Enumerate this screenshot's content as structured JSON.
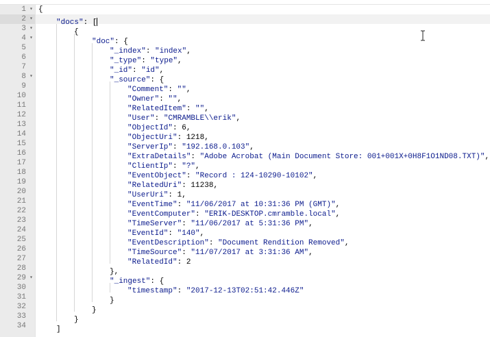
{
  "editor": {
    "active_line": 2,
    "lines": [
      {
        "n": "1",
        "fold": "▾",
        "indent": 0,
        "parts": [
          [
            "p",
            "{"
          ]
        ]
      },
      {
        "n": "2",
        "fold": "▾",
        "indent": 1,
        "parts": [
          [
            "s",
            "\"docs\""
          ],
          [
            "p",
            ": ["
          ]
        ],
        "cursor": true
      },
      {
        "n": "3",
        "fold": "▾",
        "indent": 2,
        "parts": [
          [
            "p",
            "{"
          ]
        ]
      },
      {
        "n": "4",
        "fold": "▾",
        "indent": 3,
        "parts": [
          [
            "s",
            "\"doc\""
          ],
          [
            "p",
            ": {"
          ]
        ]
      },
      {
        "n": "5",
        "fold": "",
        "indent": 4,
        "parts": [
          [
            "s",
            "\"_index\""
          ],
          [
            "p",
            ": "
          ],
          [
            "s",
            "\"index\""
          ],
          [
            "p",
            ","
          ]
        ]
      },
      {
        "n": "6",
        "fold": "",
        "indent": 4,
        "parts": [
          [
            "s",
            "\"_type\""
          ],
          [
            "p",
            ": "
          ],
          [
            "s",
            "\"type\""
          ],
          [
            "p",
            ","
          ]
        ]
      },
      {
        "n": "7",
        "fold": "",
        "indent": 4,
        "parts": [
          [
            "s",
            "\"_id\""
          ],
          [
            "p",
            ": "
          ],
          [
            "s",
            "\"id\""
          ],
          [
            "p",
            ","
          ]
        ]
      },
      {
        "n": "8",
        "fold": "▾",
        "indent": 4,
        "parts": [
          [
            "s",
            "\"_source\""
          ],
          [
            "p",
            ": {"
          ]
        ]
      },
      {
        "n": "9",
        "fold": "",
        "indent": 5,
        "parts": [
          [
            "s",
            "\"Comment\""
          ],
          [
            "p",
            ": "
          ],
          [
            "s",
            "\"\""
          ],
          [
            "p",
            ","
          ]
        ]
      },
      {
        "n": "10",
        "fold": "",
        "indent": 5,
        "parts": [
          [
            "s",
            "\"Owner\""
          ],
          [
            "p",
            ": "
          ],
          [
            "s",
            "\"\""
          ],
          [
            "p",
            ","
          ]
        ]
      },
      {
        "n": "11",
        "fold": "",
        "indent": 5,
        "parts": [
          [
            "s",
            "\"RelatedItem\""
          ],
          [
            "p",
            ": "
          ],
          [
            "s",
            "\"\""
          ],
          [
            "p",
            ","
          ]
        ]
      },
      {
        "n": "12",
        "fold": "",
        "indent": 5,
        "parts": [
          [
            "s",
            "\"User\""
          ],
          [
            "p",
            ": "
          ],
          [
            "s",
            "\"CMRAMBLE\\\\erik\""
          ],
          [
            "p",
            ","
          ]
        ]
      },
      {
        "n": "13",
        "fold": "",
        "indent": 5,
        "parts": [
          [
            "s",
            "\"ObjectId\""
          ],
          [
            "p",
            ": "
          ],
          [
            "n",
            "6"
          ],
          [
            "p",
            ","
          ]
        ]
      },
      {
        "n": "14",
        "fold": "",
        "indent": 5,
        "parts": [
          [
            "s",
            "\"ObjectUri\""
          ],
          [
            "p",
            ": "
          ],
          [
            "n",
            "1218"
          ],
          [
            "p",
            ","
          ]
        ]
      },
      {
        "n": "15",
        "fold": "",
        "indent": 5,
        "parts": [
          [
            "s",
            "\"ServerIp\""
          ],
          [
            "p",
            ": "
          ],
          [
            "s",
            "\"192.168.0.103\""
          ],
          [
            "p",
            ","
          ]
        ]
      },
      {
        "n": "16",
        "fold": "",
        "indent": 5,
        "parts": [
          [
            "s",
            "\"ExtraDetails\""
          ],
          [
            "p",
            ": "
          ],
          [
            "s",
            "\"Adobe Acrobat (Main Document Store: 001+001X+0H8F1O1ND08.TXT)\""
          ],
          [
            "p",
            ","
          ]
        ]
      },
      {
        "n": "17",
        "fold": "",
        "indent": 5,
        "parts": [
          [
            "s",
            "\"ClientIp\""
          ],
          [
            "p",
            ": "
          ],
          [
            "s",
            "\"?\""
          ],
          [
            "p",
            ","
          ]
        ]
      },
      {
        "n": "18",
        "fold": "",
        "indent": 5,
        "parts": [
          [
            "s",
            "\"EventObject\""
          ],
          [
            "p",
            ": "
          ],
          [
            "s",
            "\"Record : 124-10290-10102\""
          ],
          [
            "p",
            ","
          ]
        ]
      },
      {
        "n": "19",
        "fold": "",
        "indent": 5,
        "parts": [
          [
            "s",
            "\"RelatedUri\""
          ],
          [
            "p",
            ": "
          ],
          [
            "n",
            "11238"
          ],
          [
            "p",
            ","
          ]
        ]
      },
      {
        "n": "20",
        "fold": "",
        "indent": 5,
        "parts": [
          [
            "s",
            "\"UserUri\""
          ],
          [
            "p",
            ": "
          ],
          [
            "n",
            "1"
          ],
          [
            "p",
            ","
          ]
        ]
      },
      {
        "n": "21",
        "fold": "",
        "indent": 5,
        "parts": [
          [
            "s",
            "\"EventTime\""
          ],
          [
            "p",
            ": "
          ],
          [
            "s",
            "\"11/06/2017 at 10:31:36 PM (GMT)\""
          ],
          [
            "p",
            ","
          ]
        ]
      },
      {
        "n": "22",
        "fold": "",
        "indent": 5,
        "parts": [
          [
            "s",
            "\"EventComputer\""
          ],
          [
            "p",
            ": "
          ],
          [
            "s",
            "\"ERIK-DESKTOP.cmramble.local\""
          ],
          [
            "p",
            ","
          ]
        ]
      },
      {
        "n": "23",
        "fold": "",
        "indent": 5,
        "parts": [
          [
            "s",
            "\"TimeServer\""
          ],
          [
            "p",
            ": "
          ],
          [
            "s",
            "\"11/06/2017 at 5:31:36 PM\""
          ],
          [
            "p",
            ","
          ]
        ]
      },
      {
        "n": "24",
        "fold": "",
        "indent": 5,
        "parts": [
          [
            "s",
            "\"EventId\""
          ],
          [
            "p",
            ": "
          ],
          [
            "s",
            "\"140\""
          ],
          [
            "p",
            ","
          ]
        ]
      },
      {
        "n": "25",
        "fold": "",
        "indent": 5,
        "parts": [
          [
            "s",
            "\"EventDescription\""
          ],
          [
            "p",
            ": "
          ],
          [
            "s",
            "\"Document Rendition Removed\""
          ],
          [
            "p",
            ","
          ]
        ]
      },
      {
        "n": "26",
        "fold": "",
        "indent": 5,
        "parts": [
          [
            "s",
            "\"TimeSource\""
          ],
          [
            "p",
            ": "
          ],
          [
            "s",
            "\"11/07/2017 at 3:31:36 AM\""
          ],
          [
            "p",
            ","
          ]
        ]
      },
      {
        "n": "27",
        "fold": "",
        "indent": 5,
        "parts": [
          [
            "s",
            "\"RelatedId\""
          ],
          [
            "p",
            ": "
          ],
          [
            "n",
            "2"
          ]
        ]
      },
      {
        "n": "28",
        "fold": "",
        "indent": 4,
        "parts": [
          [
            "p",
            "},"
          ]
        ]
      },
      {
        "n": "29",
        "fold": "▾",
        "indent": 4,
        "parts": [
          [
            "s",
            "\"_ingest\""
          ],
          [
            "p",
            ": {"
          ]
        ]
      },
      {
        "n": "30",
        "fold": "",
        "indent": 5,
        "parts": [
          [
            "s",
            "\"timestamp\""
          ],
          [
            "p",
            ": "
          ],
          [
            "s",
            "\"2017-12-13T02:51:42.446Z\""
          ]
        ]
      },
      {
        "n": "31",
        "fold": "",
        "indent": 4,
        "parts": [
          [
            "p",
            "}"
          ]
        ]
      },
      {
        "n": "32",
        "fold": "",
        "indent": 3,
        "parts": [
          [
            "p",
            "}"
          ]
        ]
      },
      {
        "n": "33",
        "fold": "",
        "indent": 2,
        "parts": [
          [
            "p",
            "}"
          ]
        ]
      },
      {
        "n": "34",
        "fold": "",
        "indent": 1,
        "parts": [
          [
            "p",
            "]"
          ]
        ]
      }
    ]
  }
}
